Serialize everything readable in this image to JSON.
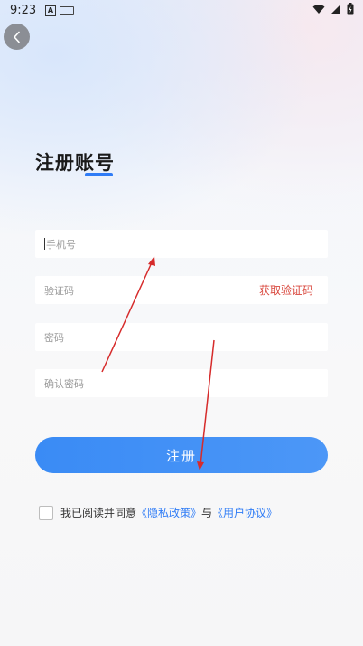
{
  "status_bar": {
    "time": "9:23",
    "a_badge": "A"
  },
  "header": {
    "back_icon": "chevron-left-icon"
  },
  "title": "注册账号",
  "fields": {
    "phone_placeholder": "手机号",
    "code_placeholder": "验证码",
    "get_code_label": "获取验证码",
    "password_placeholder": "密码",
    "confirm_placeholder": "确认密码"
  },
  "register_button": "注册",
  "agreement": {
    "prefix": "我已阅读并同意",
    "privacy_link": "《隐私政策》",
    "conjunction": "与",
    "user_link": "《用户协议》"
  },
  "colors": {
    "accent": "#2f7cf6",
    "code_link": "#d9473d",
    "annotation_arrow": "#d62b2b"
  }
}
